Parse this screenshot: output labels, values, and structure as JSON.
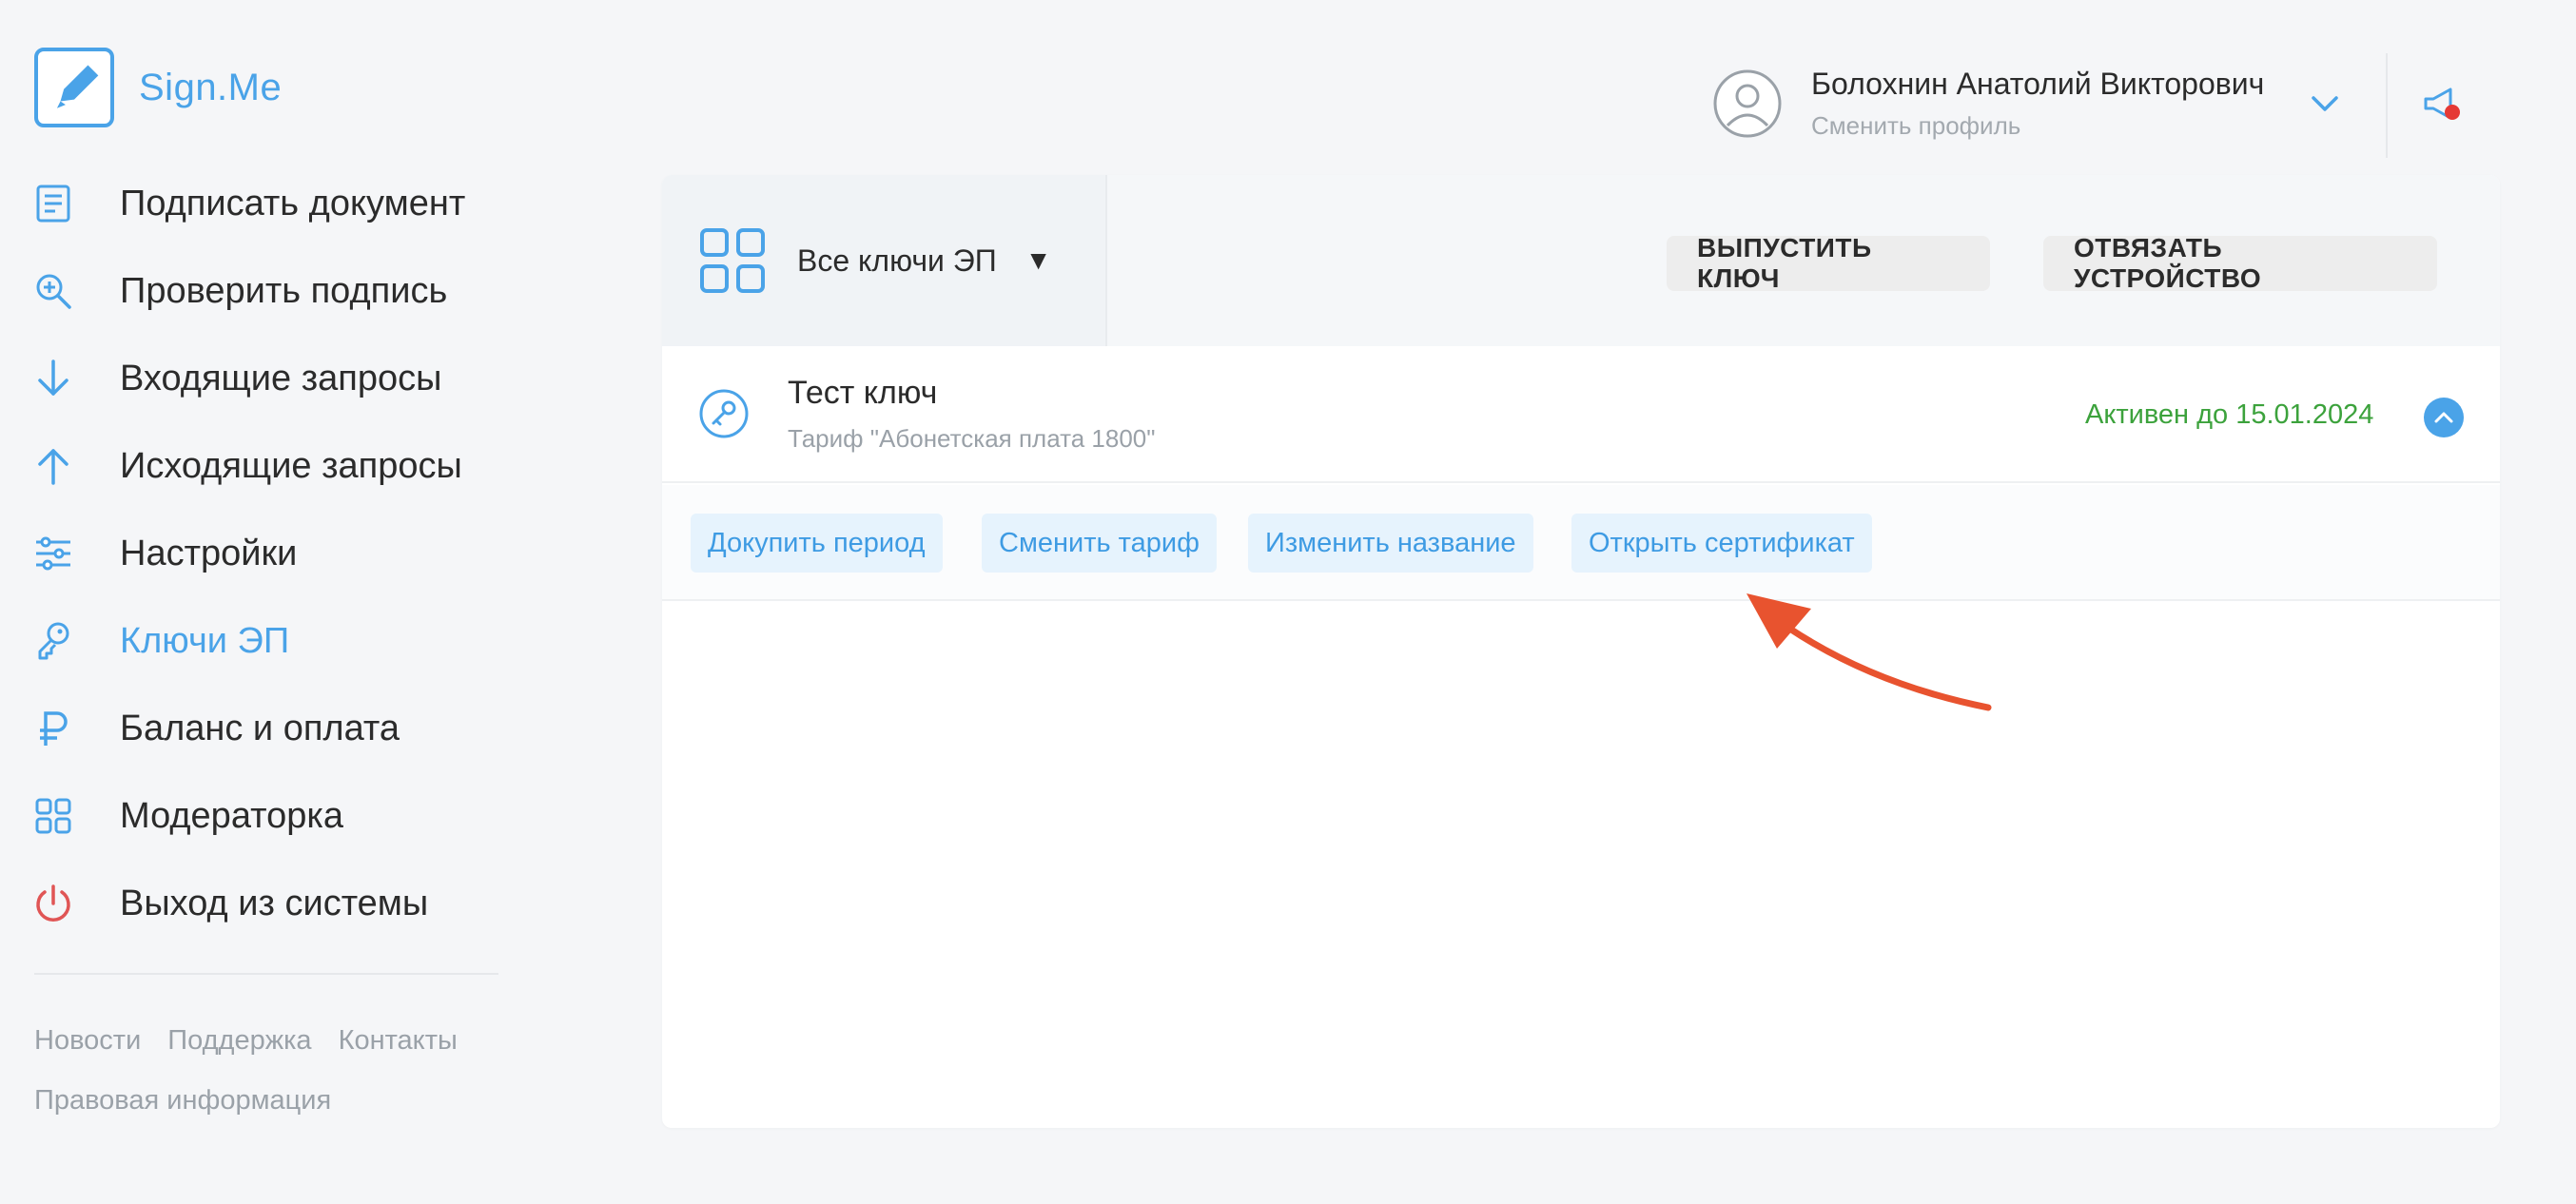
{
  "app": {
    "name": "Sign.Me"
  },
  "sidebar": {
    "items": [
      {
        "label": "Подписать документ",
        "icon": "document-icon",
        "active": false
      },
      {
        "label": "Проверить подпись",
        "icon": "magnifier-plus-icon",
        "active": false
      },
      {
        "label": "Входящие запросы",
        "icon": "arrow-down-icon",
        "active": false
      },
      {
        "label": "Исходящие запросы",
        "icon": "arrow-up-icon",
        "active": false
      },
      {
        "label": "Настройки",
        "icon": "sliders-icon",
        "active": false
      },
      {
        "label": "Ключи ЭП",
        "icon": "key-icon",
        "active": true
      },
      {
        "label": "Баланс и оплата",
        "icon": "ruble-icon",
        "active": false
      },
      {
        "label": "Модераторка",
        "icon": "grid-icon",
        "active": false
      },
      {
        "label": "Выход из системы",
        "icon": "power-icon",
        "active": false
      }
    ],
    "footer": {
      "news": "Новости",
      "support": "Поддержка",
      "contacts": "Контакты",
      "legal": "Правовая информация"
    }
  },
  "header": {
    "user_name": "Болохнин Анатолий Викторович",
    "switch_profile": "Сменить профиль"
  },
  "keys": {
    "filter_label": "Все ключи ЭП",
    "filter_caret": "▼",
    "issue_button": "ВЫПУСТИТЬ КЛЮЧ",
    "unbind_button": "ОТВЯЗАТЬ УСТРОЙСТВО",
    "item": {
      "name": "Тест ключ",
      "tariff": "Тариф \"Абонетская плата 1800\"",
      "status": "Активен до 15.01.2024"
    },
    "actions": {
      "buy_period": "Докупить период",
      "change_tariff": "Сменить тариф",
      "rename": "Изменить название",
      "open_certificate": "Открыть сертификат"
    }
  },
  "colors": {
    "accent": "#4aa3e8",
    "status_active": "#3ca23c",
    "danger": "#e05555",
    "annotation_arrow": "#e8532f"
  }
}
